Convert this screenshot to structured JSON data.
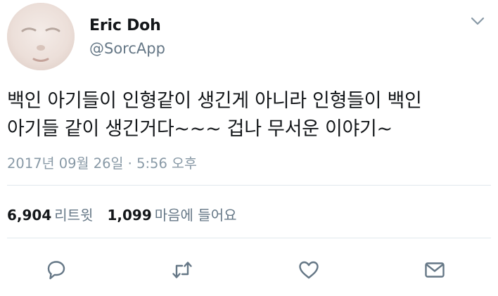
{
  "author": {
    "name": "Eric Doh",
    "handle": "@SorcApp"
  },
  "tweet": {
    "lines": [
      "백인 아기들이 인형같이 생긴게 아니라 인형들이 백인",
      "아기들 같이 생긴거다~~~ 겁나 무서운 이야기~"
    ],
    "timestamp": "2017년 09월 26일 · 5:56 오후"
  },
  "stats": {
    "retweets_count": "6,904",
    "retweets_label": "리트윗",
    "likes_count": "1,099",
    "likes_label": "마음에 들어요"
  },
  "actions": [
    "reply-icon",
    "retweet-icon",
    "heart-icon",
    "mail-icon"
  ],
  "colors": {
    "text": "#14171a",
    "secondary": "#657786",
    "timestamp": "#8899a6",
    "divider": "#e1e8ed"
  }
}
